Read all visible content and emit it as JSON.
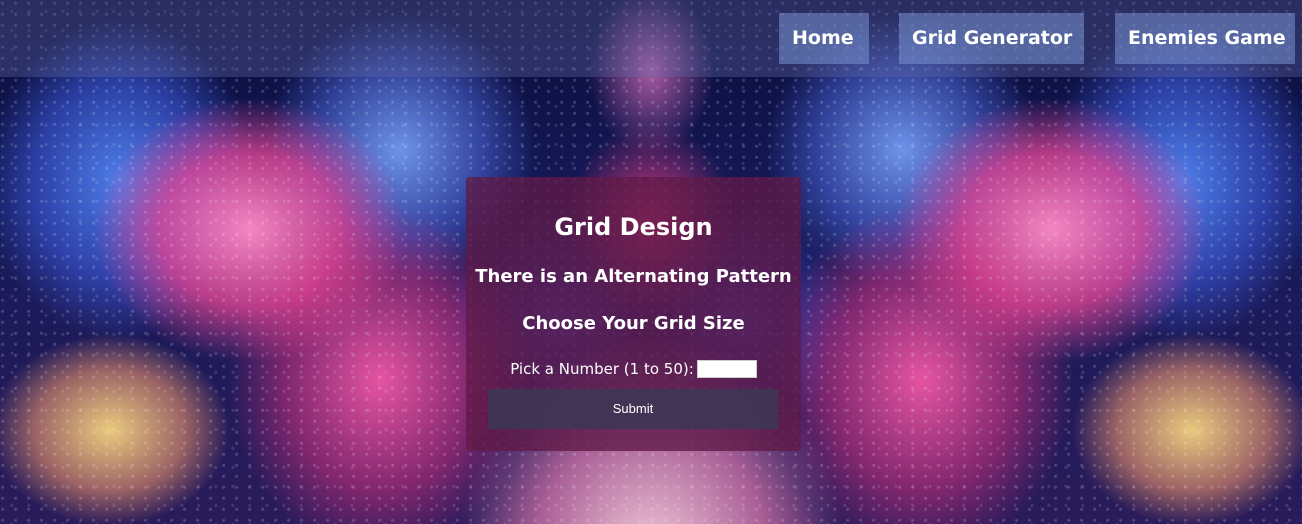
{
  "nav": {
    "home_label": "Home",
    "grid_generator_label": "Grid Generator",
    "enemies_game_label": "Enemies Game"
  },
  "panel": {
    "title": "Grid Design",
    "subtitle": "There is an Alternating Pattern",
    "prompt": "Choose Your Grid Size",
    "number_label": "Pick a Number (1 to 50):",
    "number_value": "",
    "submit_label": "Submit"
  },
  "colors": {
    "nav_bar": "#646eaa",
    "nav_button": "#7891d2",
    "panel": "#5f1946",
    "submit_button": "#3c3755",
    "text": "#ffffff"
  }
}
